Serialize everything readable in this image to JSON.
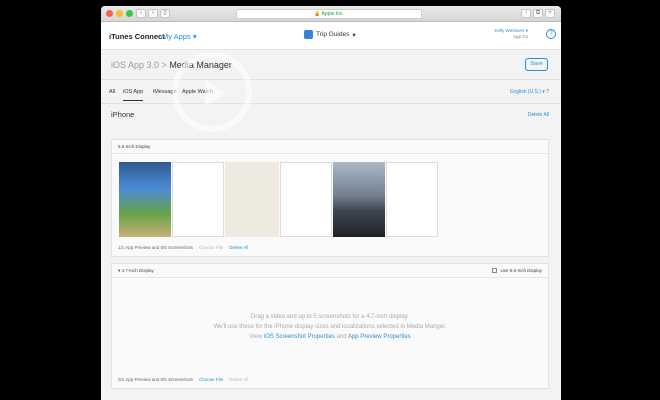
{
  "browser": {
    "url_text": "Apple Inc.",
    "traffic_colors": [
      "#fc5f57",
      "#fdbc2e",
      "#34c84a"
    ]
  },
  "header": {
    "brand": "iTunes Connect",
    "my_apps": "My Apps",
    "app_name": "Trip Guides",
    "user_name": "Kelly Westover",
    "user_company": "App Co",
    "help": "?"
  },
  "title": {
    "part1": "iOS App 3.0",
    "sep": " > ",
    "part2": "Media Manager",
    "save_label": "Save"
  },
  "tabs": [
    "All",
    "iOS App",
    "iMessage",
    "Apple Watch"
  ],
  "language": "English (U.S.)",
  "section": {
    "title": "iPhone",
    "delete_all": "Delete All"
  },
  "display55": {
    "title": "5.5-Inch Display",
    "status": "1/1 App Preview and 5/5 Screenshots",
    "choose_file": "Choose File",
    "delete_all": "Delete All"
  },
  "display47": {
    "title": "4.7-Inch Display",
    "checkbox_label": "Use 5.5-Inch Display",
    "drop_line1": "Drag a video and up to 5 screenshots for a 4.7-inch display.",
    "drop_line2": "We'll use these for the iPhone display sizes and localizations selected in Media Manger.",
    "drop_view": "View",
    "link1": "iOS Screenshot Properties",
    "drop_and": "and",
    "link2": "App Preview Properties",
    "status": "0/1 App Preview and 0/5 Screenshots",
    "choose_file": "Choose File",
    "delete_all": "Delete All"
  },
  "colors": {
    "accent": "#2a8fd6"
  }
}
